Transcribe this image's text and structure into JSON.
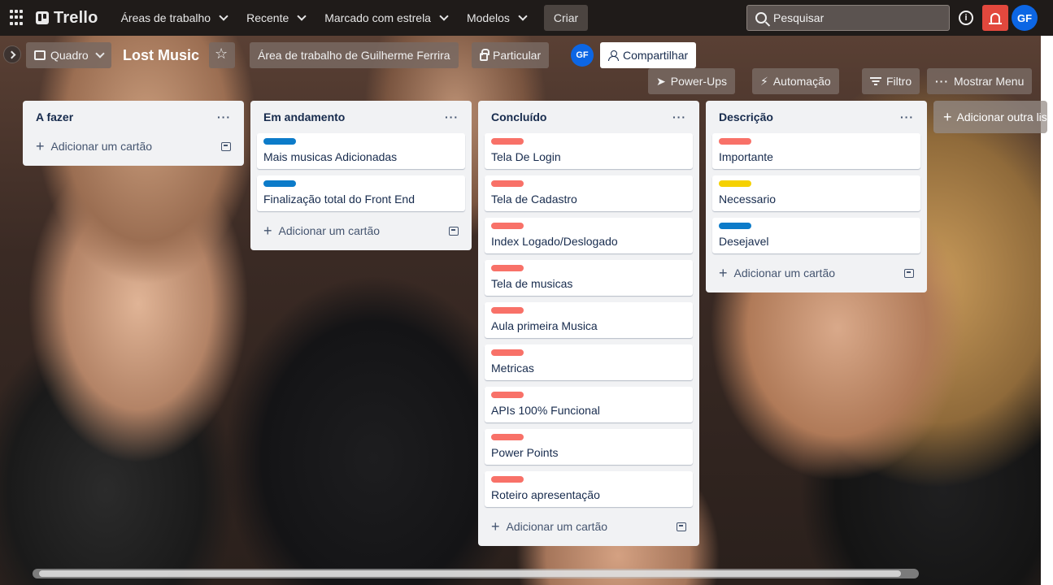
{
  "topnav": {
    "logo": "Trello",
    "menus": [
      "Áreas de trabalho",
      "Recente",
      "Marcado com estrela",
      "Modelos"
    ],
    "create_label": "Criar",
    "search_placeholder": "Pesquisar",
    "avatar_initials": "GF"
  },
  "board_header": {
    "view_label": "Quadro",
    "board_title": "Lost Music",
    "workspace_label": "Área de trabalho de Guilherme Ferrira",
    "visibility_label": "Particular",
    "member_initials": "GF",
    "share_label": "Compartilhar",
    "powerups_label": "Power-Ups",
    "automation_label": "Automação",
    "filter_label": "Filtro",
    "menu_label": "Mostrar Menu"
  },
  "colors": {
    "red": "#f87168",
    "blue": "#0c7bc9",
    "yellow": "#f5d100"
  },
  "lists": [
    {
      "title": "A fazer",
      "cards": [],
      "add_card_label": "Adicionar um cartão"
    },
    {
      "title": "Em andamento",
      "cards": [
        {
          "title": "Mais musicas Adicionadas",
          "label": "blue"
        },
        {
          "title": "Finalização total do Front End",
          "label": "blue"
        }
      ],
      "add_card_label": "Adicionar um cartão"
    },
    {
      "title": "Concluído",
      "cards": [
        {
          "title": "Tela De Login",
          "label": "red"
        },
        {
          "title": "Tela de Cadastro",
          "label": "red"
        },
        {
          "title": "Index Logado/Deslogado",
          "label": "red"
        },
        {
          "title": "Tela de musicas",
          "label": "red"
        },
        {
          "title": "Aula primeira Musica",
          "label": "red"
        },
        {
          "title": "Metricas",
          "label": "red"
        },
        {
          "title": "APIs 100% Funcional",
          "label": "red"
        },
        {
          "title": "Power Points",
          "label": "red"
        },
        {
          "title": "Roteiro apresentação",
          "label": "red"
        }
      ],
      "add_card_label": "Adicionar um cartão"
    },
    {
      "title": "Descrição",
      "cards": [
        {
          "title": "Importante",
          "label": "red"
        },
        {
          "title": "Necessario",
          "label": "yellow"
        },
        {
          "title": "Desejavel",
          "label": "blue"
        }
      ],
      "add_card_label": "Adicionar um cartão"
    }
  ],
  "add_list_label": "Adicionar outra lista"
}
